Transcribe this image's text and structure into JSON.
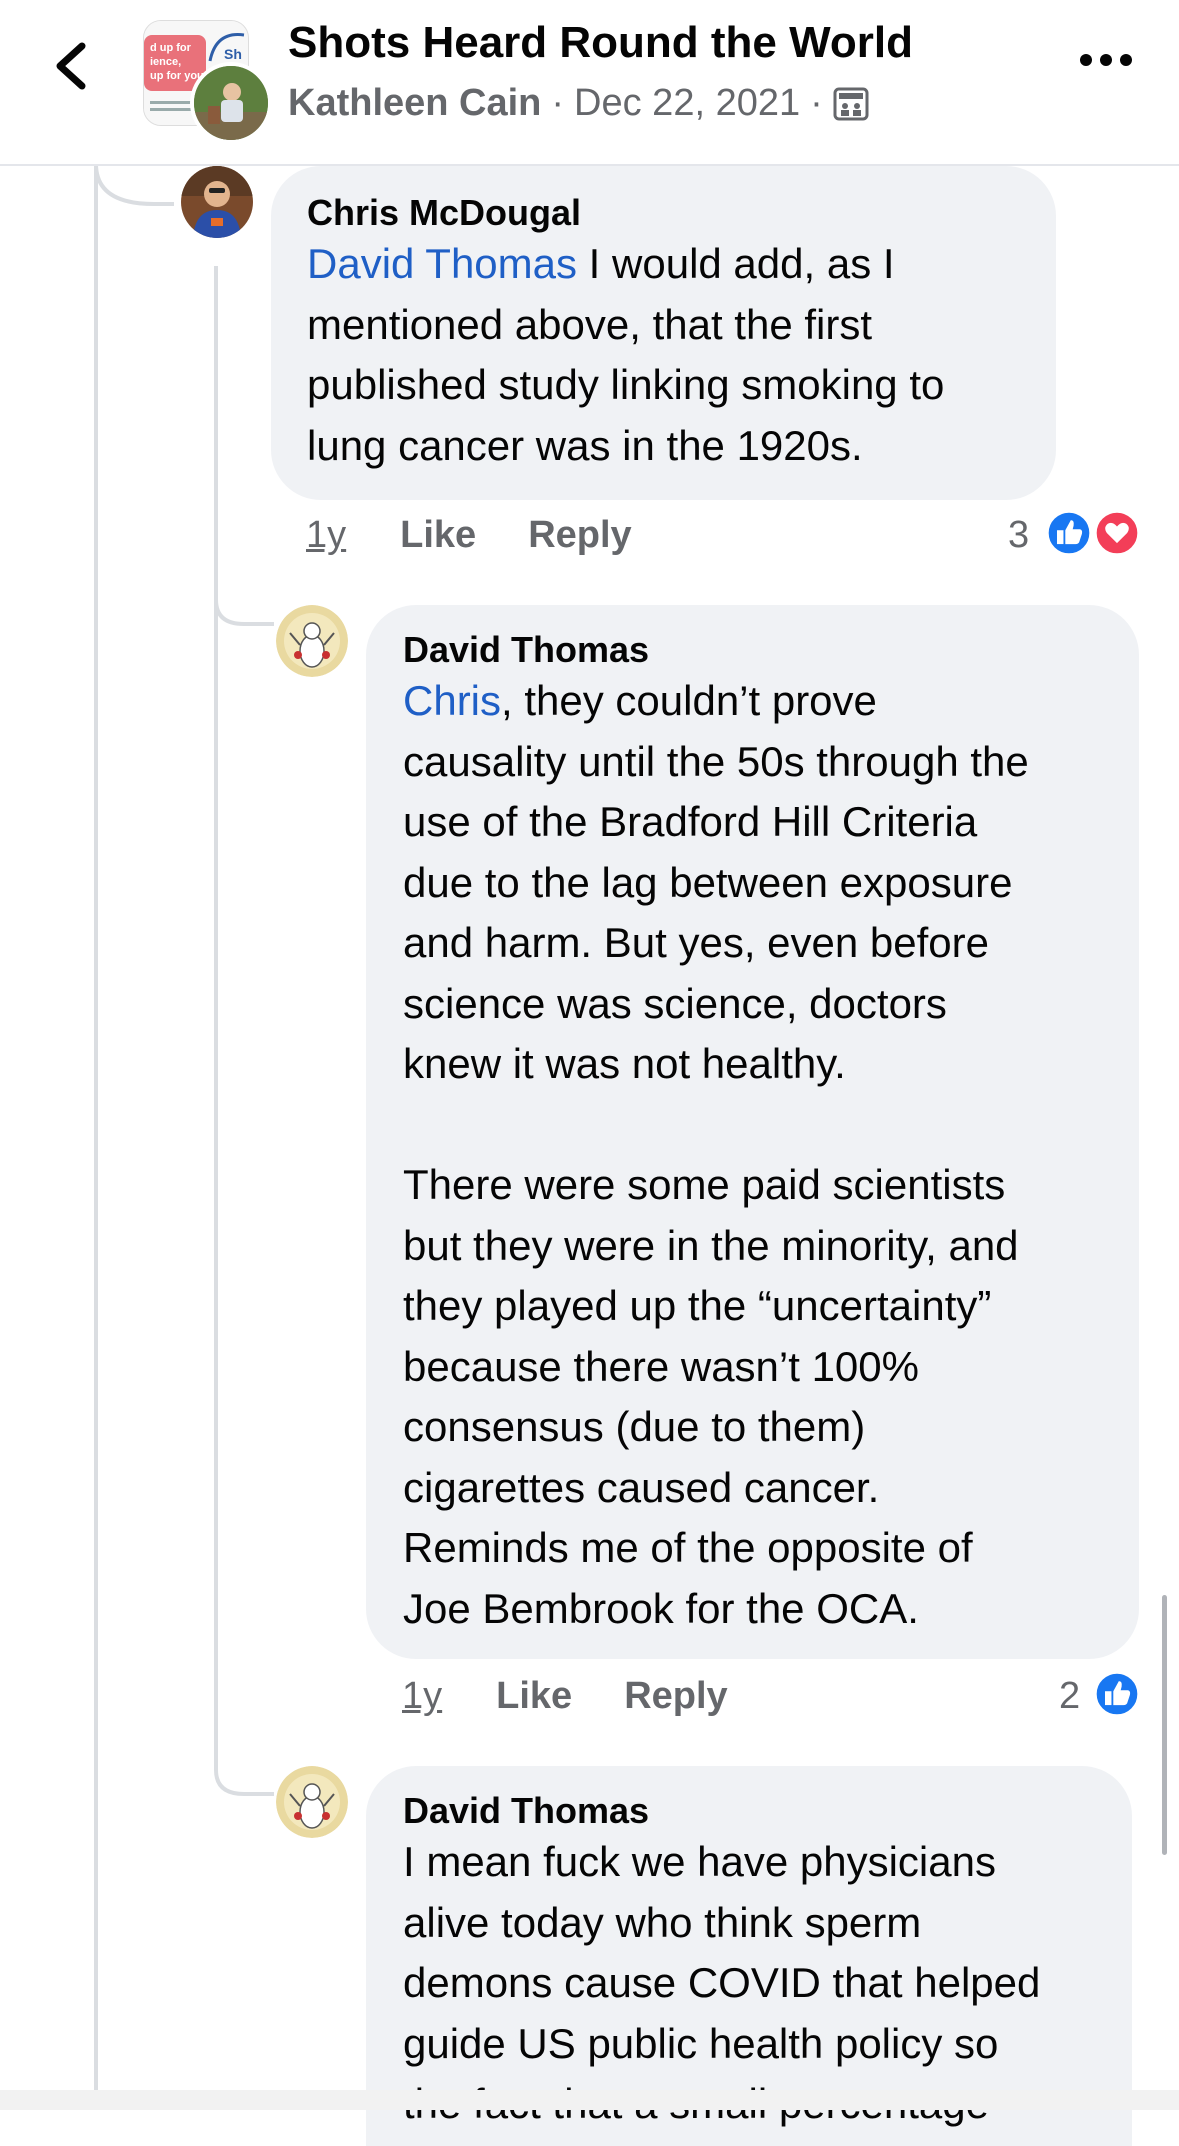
{
  "header": {
    "title": "Shots Heard Round the World",
    "author": "Kathleen Cain",
    "sep1": "·",
    "date": "Dec 22, 2021",
    "sep2": "·",
    "group_avatar_text": "d up for\nience,\nup for you"
  },
  "comments": [
    {
      "name": "Chris McDougal",
      "mention": "David Thomas",
      "text": " I would add, as I\nmentioned above, that the first\npublished study linking smoking to\nlung cancer was in the 1920s.",
      "time": "1y",
      "like": "Like",
      "reply": "Reply",
      "reaction_count": "3",
      "reactions": [
        "like-icon",
        "love-icon"
      ]
    },
    {
      "name": "David Thomas",
      "mention": "Chris",
      "text": ", they couldn’t prove\ncausality until the 50s through the\nuse of the Bradford Hill Criteria\ndue to the lag between exposure\nand harm. But yes, even before\nscience was science, doctors\nknew it was not healthy.\n\nThere were some paid scientists\nbut they were in the minority, and\nthey played up the “uncertainty”\nbecause there wasn’t 100%\nconsensus (due to them)\ncigarettes caused cancer.\nReminds me of the opposite of\nJoe Bembrook for the OCA.",
      "time": "1y",
      "like": "Like",
      "reply": "Reply",
      "reaction_count": "2",
      "reactions": [
        "like-icon"
      ]
    },
    {
      "name": "David Thomas",
      "text": "I mean fuck we have physicians\nalive today who think sperm\ndemons cause COVID that helped\nguide US public health policy so\nthe fact that a small percentage"
    }
  ],
  "colors": {
    "mention": "#1f5fc6",
    "bubble": "#f0f2f5",
    "like": "#1877f2",
    "love": "#f33e58"
  }
}
